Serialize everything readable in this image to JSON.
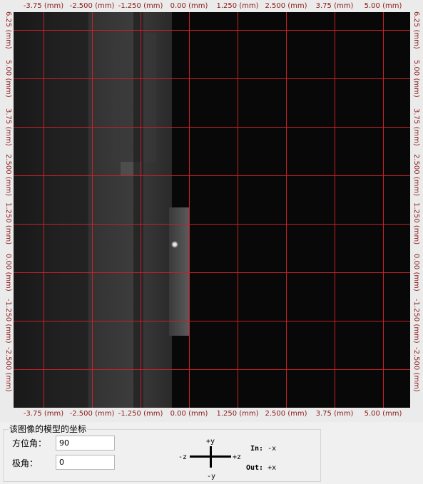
{
  "viewer": {
    "top_ticks": [
      "-3.75 (mm)",
      "-2.500 (mm)",
      "-1.250 (mm)",
      "0.00 (mm)",
      "1.250 (mm)",
      "2.500 (mm)",
      "3.75 (mm)",
      "5.00 (mm)"
    ],
    "bottom_ticks": [
      "-3.75 (mm)",
      "-2.500 (mm)",
      "-1.250 (mm)",
      "0.00 (mm)",
      "1.250 (mm)",
      "2.500 (mm)",
      "3.75 (mm)",
      "5.00 (mm)"
    ],
    "left_ticks": [
      "6.25 (mm)",
      "5.00 (mm)",
      "3.75 (mm)",
      "2.500 (mm)",
      "1.250 (mm)",
      "0.00 (mm)",
      "-1.250 (mm)",
      "-2.500 (mm)"
    ],
    "right_ticks": [
      "6.25 (mm)",
      "5.00 (mm)",
      "3.75 (mm)",
      "2.500 (mm)",
      "1.250 (mm)",
      "0.00 (mm)",
      "-1.250 (mm)",
      "-2.500 (mm)"
    ],
    "grid_color": "#c8202a",
    "tick_color": "#8b1a1a",
    "background_color": "#080808"
  },
  "model_panel": {
    "title": "该图像的模型的坐标",
    "azimuth_label": "方位角：",
    "azimuth_value": "90",
    "polar_label": "极角：",
    "polar_value": "0"
  },
  "axis_icon": {
    "plus_y": "+y",
    "minus_y": "-y",
    "plus_z": "+z",
    "minus_z": "-z"
  },
  "in_out": {
    "in_label": "In:",
    "in_value": "-x",
    "out_label": "Out:",
    "out_value": "+x"
  }
}
